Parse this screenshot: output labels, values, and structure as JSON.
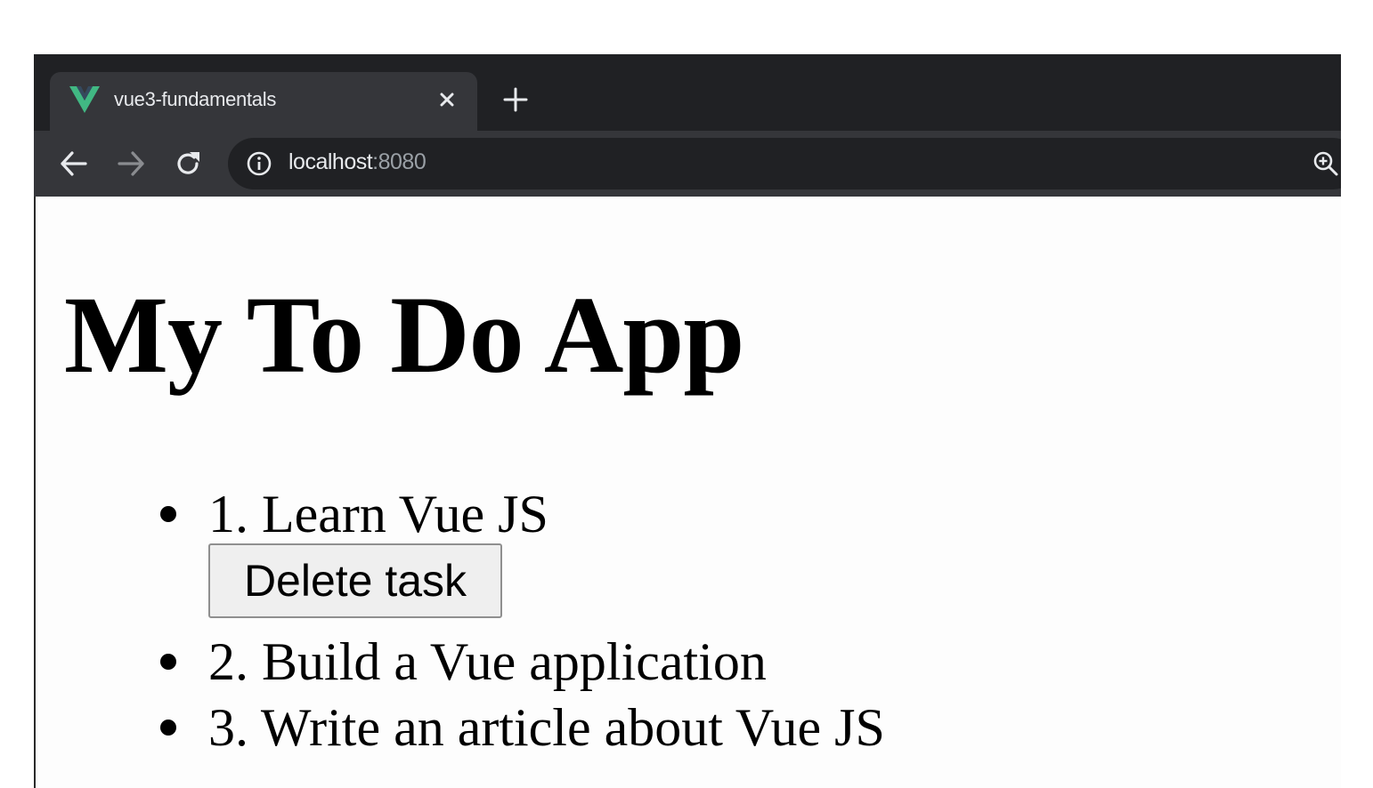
{
  "browser": {
    "tab": {
      "title": "vue3-fundamentals",
      "favicon": "vue-logo-icon",
      "favicon_color": "#41b883"
    },
    "toolbar": {
      "url_host": "localhost",
      "url_port": ":8080"
    }
  },
  "page": {
    "title": "My To Do App",
    "tasks": [
      {
        "text": "1. Learn Vue JS",
        "delete_label": "Delete task"
      },
      {
        "text": "2. Build a Vue application"
      },
      {
        "text": "3. Write an article about Vue JS"
      }
    ]
  },
  "colors": {
    "tabstrip": "#202124",
    "toolbar": "#35363a",
    "omnibox": "#202124",
    "page_background": "#fdfdfd"
  }
}
